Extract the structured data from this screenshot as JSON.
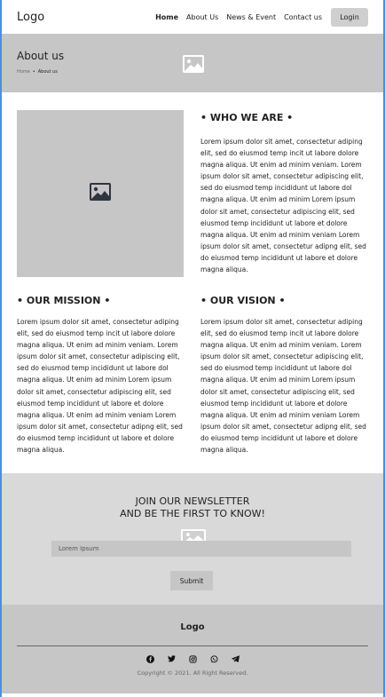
{
  "header": {
    "logo": "Logo",
    "nav": [
      "Home",
      "About Us",
      "News & Event",
      "Contact us"
    ],
    "login": "Login"
  },
  "hero": {
    "title": "About us",
    "breadcrumb": {
      "home": "Home",
      "sep": "•",
      "current": "About us"
    },
    "image_icon": "image-icon"
  },
  "about": {
    "image_icon": "image-icon",
    "who_heading": "• WHO WE ARE •",
    "who_text": "Lorem ipsum dolor sit amet, consectetur adiping elit, sed do eiusmod temp incit ut labore dolore magna aliqua. Ut enim ad minim veniam. Lorem ipsum dolor sit amet, consectetur adipiscing elit, sed do eiusmod temp incididunt ut labore dol magna aliqua. Ut enim ad minim Lorem ipsum dolor sit amet, consectetur adipiscing elit, sed eiusmod temp incididunt ut labore et dolore magna aliqua. Ut enim ad minim veniam Lorem ipsum dolor sit amet, consectetur adipng elit, sed do eiusmod temp incididunt ut labore et dolore magna aliqua.",
    "mission_heading": "• OUR MISSION •",
    "mission_text": "Lorem ipsum dolor sit amet, consectetur adiping elit, sed do eiusmod temp incit ut labore dolore magna aliqua. Ut enim ad minim veniam. Lorem ipsum dolor sit amet, consectetur adipiscing elit, sed do eiusmod temp incididunt ut labore dol magna aliqua. Ut enim ad minim Lorem ipsum dolor sit amet, consectetur adipiscing elit, sed eiusmod temp incididunt ut labore et dolore magna aliqua. Ut enim ad minim veniam Lorem ipsum dolor sit amet, consectetur adipng elit, sed do eiusmod temp incididunt ut labore et dolore magna aliqua.",
    "vision_heading": "• OUR VISION •",
    "vision_text": "Lorem ipsum dolor sit amet, consectetur adiping elit, sed do eiusmod temp incit ut labore dolore magna aliqua. Ut enim ad minim veniam. Lorem ipsum dolor sit amet, consectetur adipiscing elit, sed do eiusmod temp incididunt ut labore dol magna aliqua. Ut enim ad minim Lorem ipsum dolor sit amet, consectetur adipiscing elit, sed eiusmod temp incididunt ut labore et dolore magna aliqua. Ut enim ad minim veniam Lorem ipsum dolor sit amet, consectetur adipng elit, sed do eiusmod temp incididunt ut labore et dolore magna aliqua."
  },
  "newsletter": {
    "line1": "JOIN OUR NEWSLETTER",
    "line2": "AND BE THE FIRST TO KNOW!",
    "placeholder": "Lorem Ipsum",
    "submit": "Submit"
  },
  "footer": {
    "logo": "Logo",
    "social": [
      "facebook-icon",
      "twitter-icon",
      "instagram-icon",
      "whatsapp-icon",
      "telegram-icon"
    ],
    "copyright": "Copyright © 2021. All Right Reserved."
  }
}
